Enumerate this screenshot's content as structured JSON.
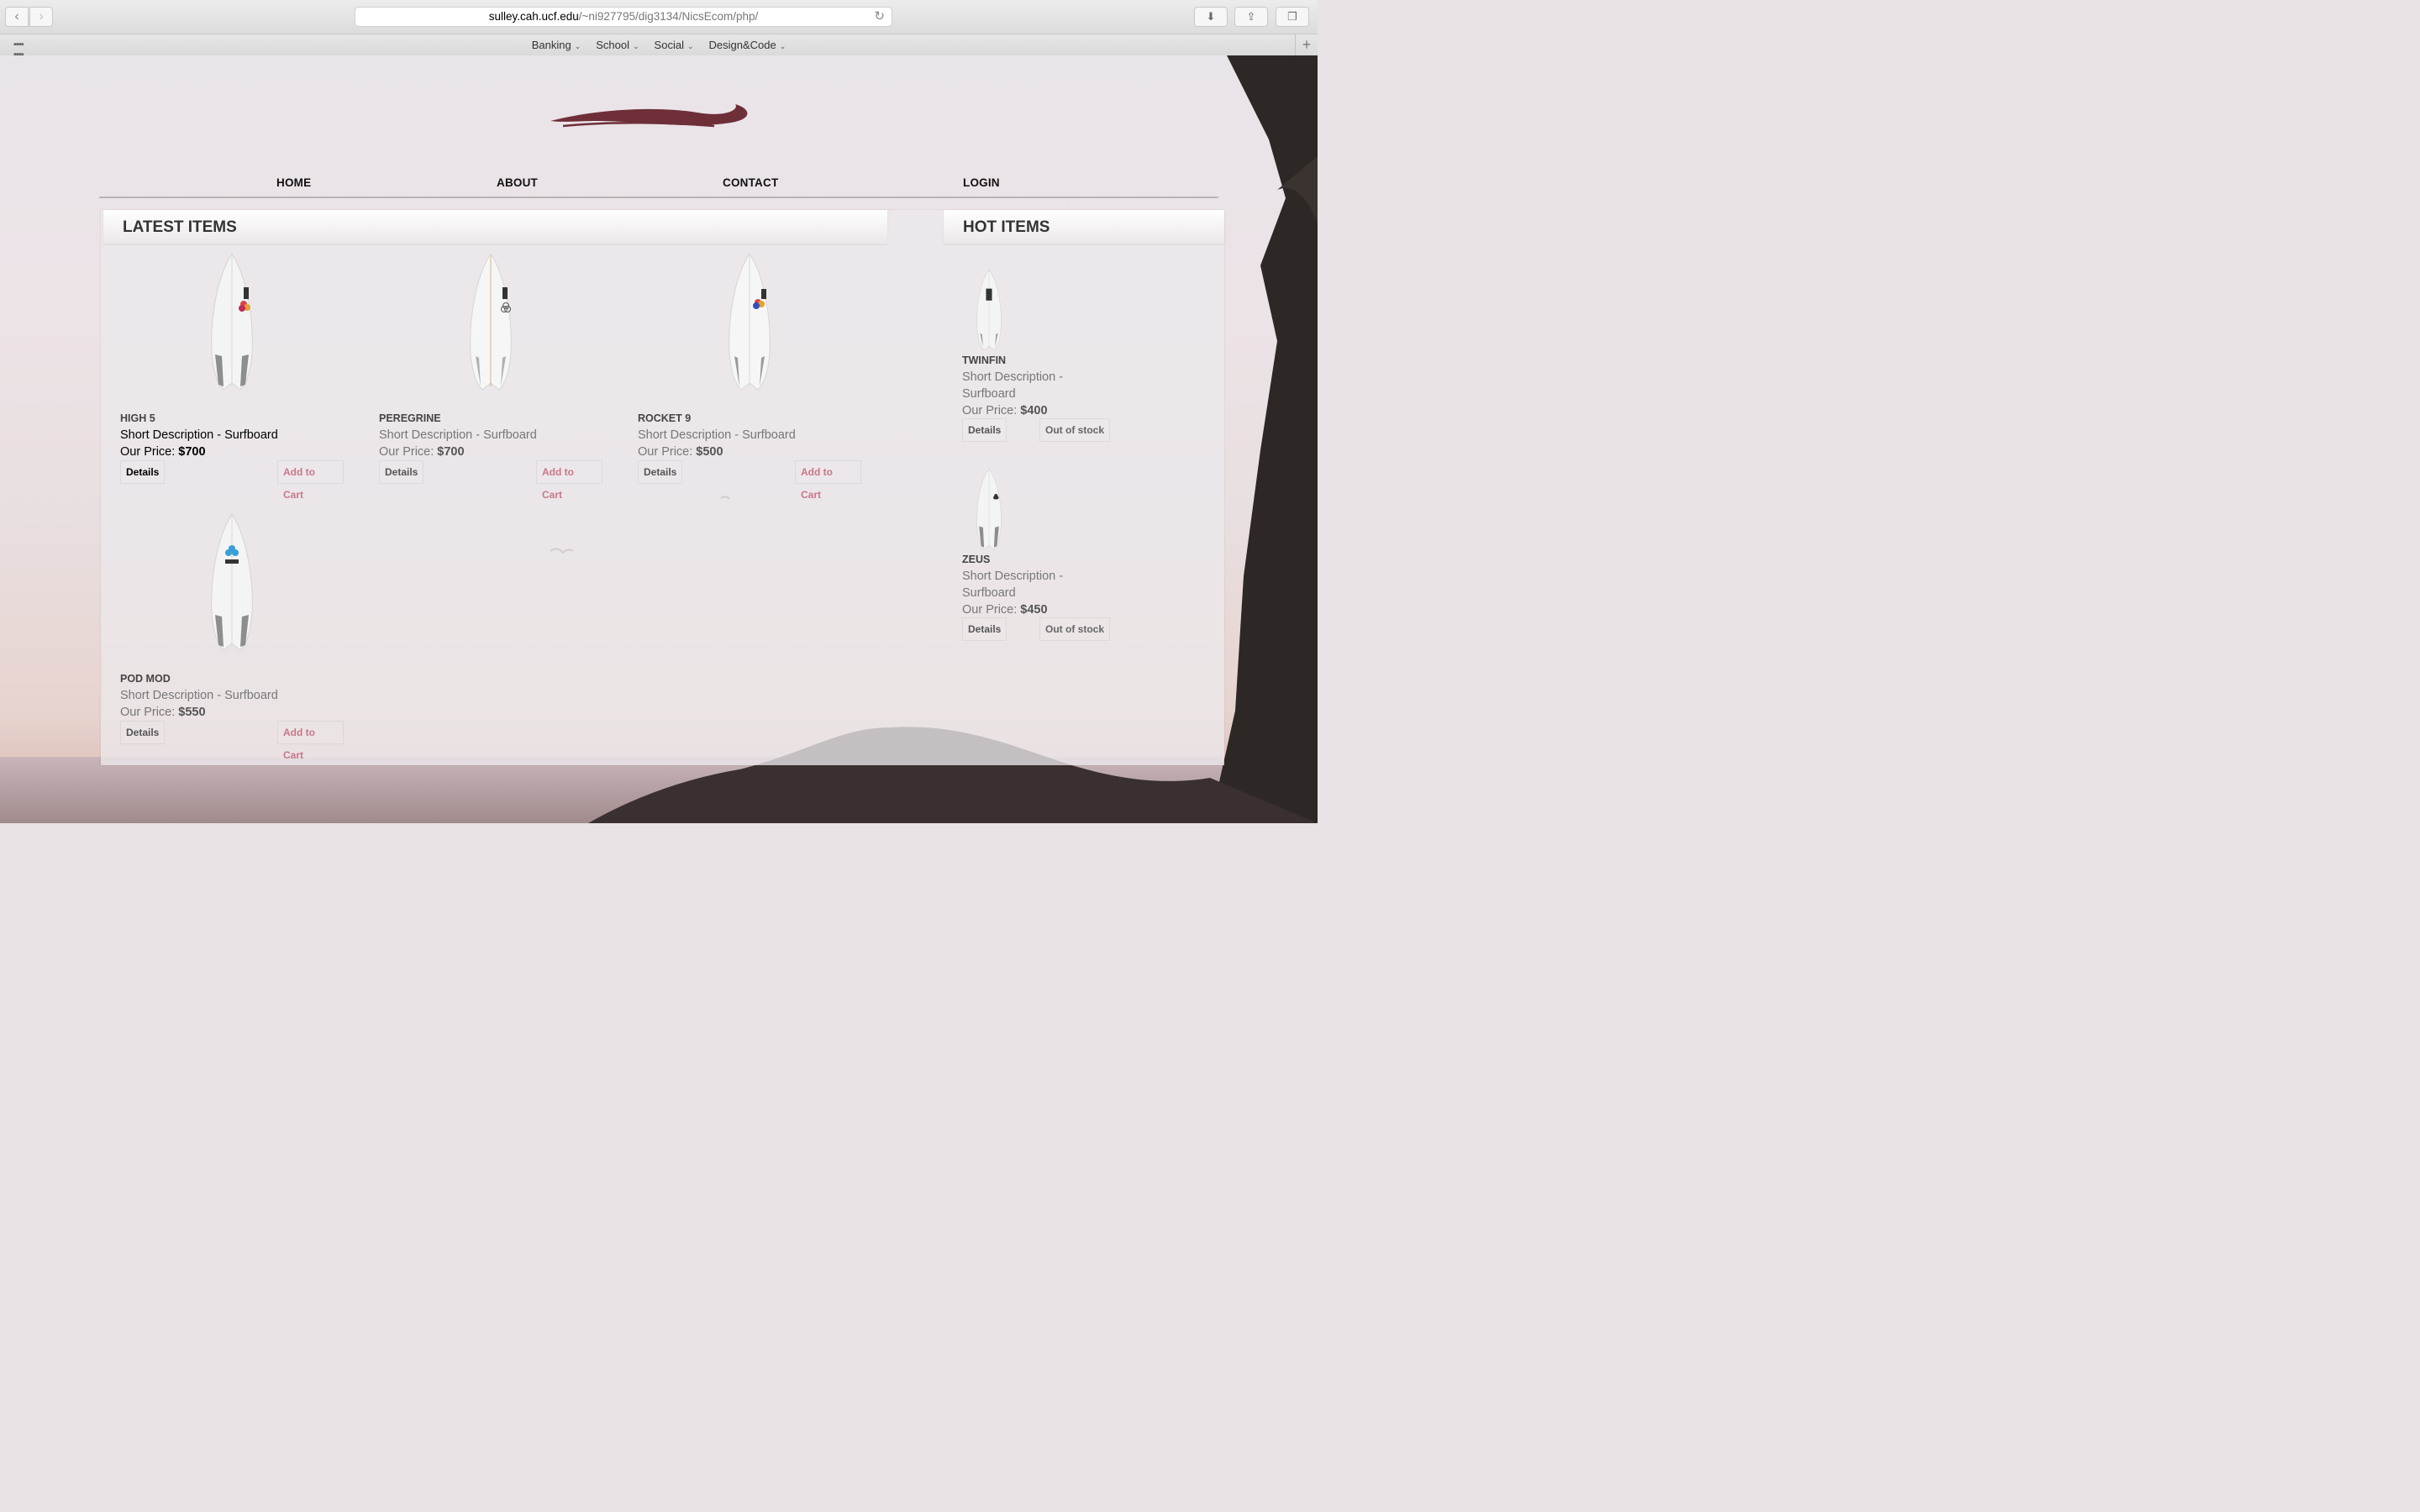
{
  "browser": {
    "url_host": "sulley.cah.ucf.edu",
    "url_path": "/~ni927795/dig3134/NicsEcom/php/",
    "bookmarks": [
      "Banking",
      "School",
      "Social",
      "Design&Code"
    ]
  },
  "nav": {
    "home": "HOME",
    "about": "ABOUT",
    "contact": "CONTACT",
    "login": "LOGIN"
  },
  "latest": {
    "title": "LATEST ITEMS",
    "items": [
      {
        "name": "HIGH 5",
        "desc": "Short Description - Surfboard",
        "price_label": "Our Price:",
        "price": "$700",
        "details": "Details",
        "cart": "Add to Cart"
      },
      {
        "name": "PEREGRINE",
        "desc": "Short Description - Surfboard",
        "price_label": "Our Price:",
        "price": "$700",
        "details": "Details",
        "cart": "Add to Cart"
      },
      {
        "name": "ROCKET 9",
        "desc": "Short Description - Surfboard",
        "price_label": "Our Price:",
        "price": "$500",
        "details": "Details",
        "cart": "Add to Cart"
      },
      {
        "name": "POD MOD",
        "desc": "Short Description - Surfboard",
        "price_label": "Our Price:",
        "price": "$550",
        "details": "Details",
        "cart": "Add to Cart"
      }
    ]
  },
  "hot": {
    "title": "HOT ITEMS",
    "items": [
      {
        "name": "TWINFIN",
        "desc1": "Short Description -",
        "desc2": "Surfboard",
        "price_label": "Our Price:",
        "price": "$400",
        "details": "Details",
        "stock": "Out of stock"
      },
      {
        "name": "ZEUS",
        "desc1": "Short Description -",
        "desc2": "Surfboard",
        "price_label": "Our Price:",
        "price": "$450",
        "details": "Details",
        "stock": "Out of stock"
      }
    ]
  },
  "colors": {
    "accent_cart": "#c9778a",
    "logo": "#6e2f38"
  }
}
